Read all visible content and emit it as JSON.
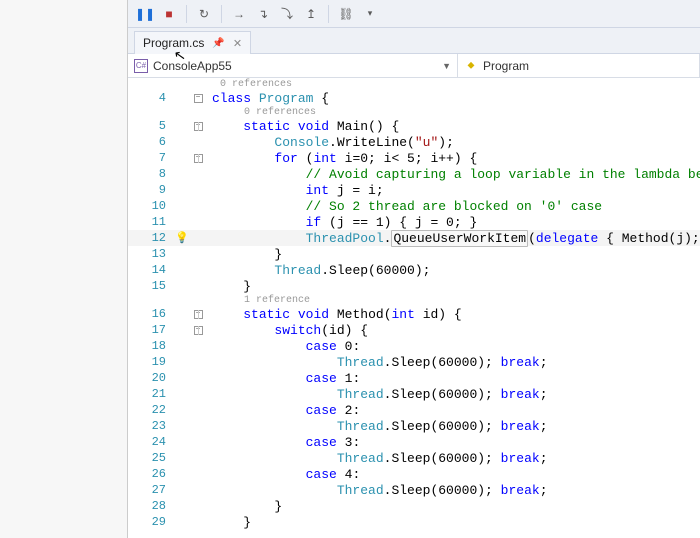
{
  "toolbar": {
    "items": [
      "pause",
      "stop",
      "restart",
      "step-into",
      "step-over",
      "step-out",
      "step",
      "show-threads",
      "dropdown"
    ]
  },
  "tab": {
    "name": "Program.cs"
  },
  "nav": {
    "left_icon": "C#",
    "left": "ConsoleApp55",
    "right_icon": "⬥",
    "right": "Program"
  },
  "refs": {
    "r0": "0 references",
    "r1": "0 references",
    "r2": "1 reference"
  },
  "code": {
    "l4": {
      "n": "4"
    },
    "l5": {
      "n": "5"
    },
    "l6": {
      "n": "6"
    },
    "l7": {
      "n": "7"
    },
    "l8": {
      "n": "8"
    },
    "l9": {
      "n": "9"
    },
    "l10": {
      "n": "10"
    },
    "l11": {
      "n": "11"
    },
    "l12": {
      "n": "12"
    },
    "l13": {
      "n": "13"
    },
    "l14": {
      "n": "14"
    },
    "l15": {
      "n": "15"
    },
    "l16": {
      "n": "16"
    },
    "l17": {
      "n": "17"
    },
    "l18": {
      "n": "18"
    },
    "l19": {
      "n": "19"
    },
    "l20": {
      "n": "20"
    },
    "l21": {
      "n": "21"
    },
    "l22": {
      "n": "22"
    },
    "l23": {
      "n": "23"
    },
    "l24": {
      "n": "24"
    },
    "l25": {
      "n": "25"
    },
    "l26": {
      "n": "26"
    },
    "l27": {
      "n": "27"
    },
    "l28": {
      "n": "28"
    },
    "l29": {
      "n": "29"
    }
  },
  "tok": {
    "class": "class",
    "Program": "Program",
    "lb": " {",
    "rb": "}",
    "static": "static",
    "void": "void",
    "Main": "Main",
    "paren": "() {",
    "Console": "Console",
    "WriteLine": ".WriteLine(",
    "strU": "\"u\"",
    "clp": ");",
    "for": "for",
    "forH": " (",
    "int": "int",
    "iEq": " i=0; i< 5; i++) {",
    "c1": "// Avoid capturing a loop variable in the lambda below",
    "jEq": " j = i;",
    "c2": "// So 2 thread are blocked on '0' case",
    "if": "if",
    "ifH": " (j == 1) { j = 0; }",
    "ThreadPool": "ThreadPool",
    "QUWI": ".",
    "QUWI2": "QueueUserWorkItem",
    "QUWI3": "(",
    "delegate": "delegate",
    "delH": " { Method(j); });",
    "closeB": "    }",
    "Thread": "Thread",
    "Sleep": ".Sleep(60000);",
    "Method": "Method",
    "MethodH": "(",
    "intId": " id) {",
    "switch": "switch",
    "switchH": "(id) {",
    "case": "case",
    "c0": " 0:",
    "c1n": " 1:",
    "c2n": " 2:",
    "c3n": " 3:",
    "c4n": " 4:",
    "break": "break",
    "semib": ";",
    "ThreadSleepBreak": ".Sleep(60000); "
  }
}
